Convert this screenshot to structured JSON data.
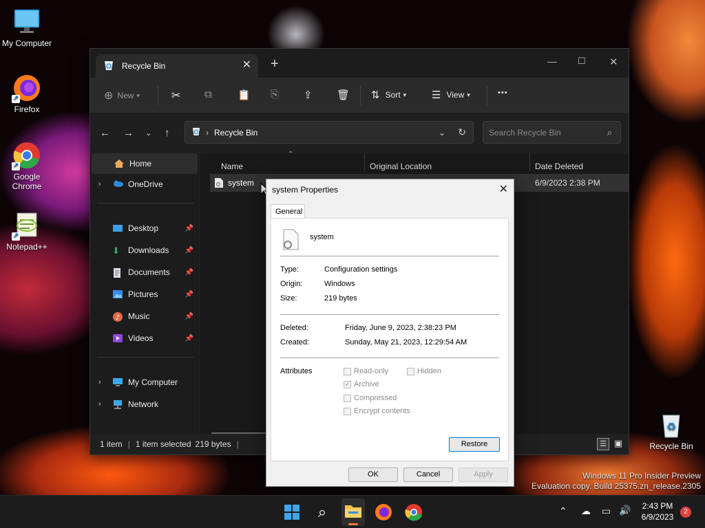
{
  "desktop": {
    "icons": [
      {
        "label": "My Computer"
      },
      {
        "label": "Firefox"
      },
      {
        "label": "Google Chrome"
      },
      {
        "label": "Notepad++"
      },
      {
        "label": "Recycle Bin"
      }
    ],
    "watermark": {
      "line1": "Windows 11 Pro Insider Preview",
      "line2": "Evaluation copy. Build 25375.zn_release.2305"
    }
  },
  "explorer": {
    "tab_title": "Recycle Bin",
    "toolbar": {
      "new_label": "New",
      "sort_label": "Sort",
      "view_label": "View",
      "more_label": "•••"
    },
    "address": {
      "path": "Recycle Bin"
    },
    "search": {
      "placeholder": "Search Recycle Bin"
    },
    "sidebar": {
      "items": [
        {
          "label": "Home"
        },
        {
          "label": "OneDrive"
        },
        {
          "label": "Desktop"
        },
        {
          "label": "Downloads"
        },
        {
          "label": "Documents"
        },
        {
          "label": "Pictures"
        },
        {
          "label": "Music"
        },
        {
          "label": "Videos"
        },
        {
          "label": "My Computer"
        },
        {
          "label": "Network"
        }
      ]
    },
    "columns": [
      "Name",
      "Original Location",
      "Date Deleted"
    ],
    "rows": [
      {
        "name": "system",
        "date_deleted": "6/9/2023 2:38 PM"
      }
    ],
    "status": {
      "items": "1 item",
      "selected": "1 item selected",
      "size": "219 bytes"
    }
  },
  "dialog": {
    "title": "system Properties",
    "tab": "General",
    "file_name": "system",
    "fields": [
      {
        "label": "Type:",
        "value": "Configuration settings"
      },
      {
        "label": "Origin:",
        "value": "Windows"
      },
      {
        "label": "Size:",
        "value": "219 bytes"
      }
    ],
    "dates": [
      {
        "label": "Deleted:",
        "value": "Friday, June 9, 2023, 2:38:23 PM"
      },
      {
        "label": "Created:",
        "value": "Sunday, May 21, 2023, 12:29:54 AM"
      }
    ],
    "attributes_label": "Attributes",
    "attributes": [
      {
        "label": "Read-only",
        "checked": false
      },
      {
        "label": "Hidden",
        "checked": false
      },
      {
        "label": "Archive",
        "checked": true
      },
      {
        "label": "Compressed",
        "checked": false
      },
      {
        "label": "Encrypt contents",
        "checked": false
      }
    ],
    "restore_label": "Restore",
    "ok_label": "OK",
    "cancel_label": "Cancel",
    "apply_label": "Apply"
  },
  "taskbar": {
    "time": "2:43 PM",
    "date": "6/9/2023",
    "notification_count": "2"
  },
  "colors": {
    "accent": "#0078d4",
    "folder_yellow": "#f2c14e",
    "badge_red": "#e0433e"
  }
}
